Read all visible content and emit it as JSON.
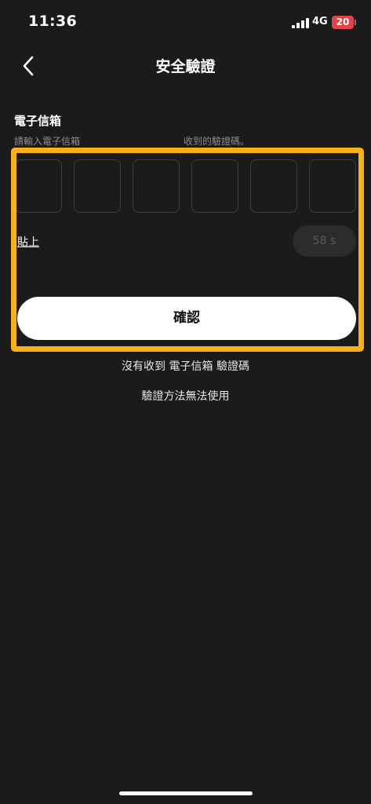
{
  "status_bar": {
    "time": "11:36",
    "network": "4G",
    "battery": "20",
    "battery_color": "#e0434a"
  },
  "header": {
    "title": "安全驗證",
    "back_icon": "chevron-left-icon"
  },
  "verification": {
    "section_title": "電子信箱",
    "hint_left": "請輸入電子信箱",
    "hint_right": "收到的驗證碼。",
    "code_boxes": [
      "",
      "",
      "",
      "",
      "",
      ""
    ],
    "paste_label": "貼上",
    "countdown": "58 s",
    "confirm_label": "確認"
  },
  "footer_links": {
    "no_code": "沒有收到 電子信箱 驗證碼",
    "method_unavailable": "驗證方法無法使用"
  },
  "colors": {
    "background": "#1b1b1c",
    "highlight": "#f8b118",
    "button_bg": "#ffffff"
  }
}
